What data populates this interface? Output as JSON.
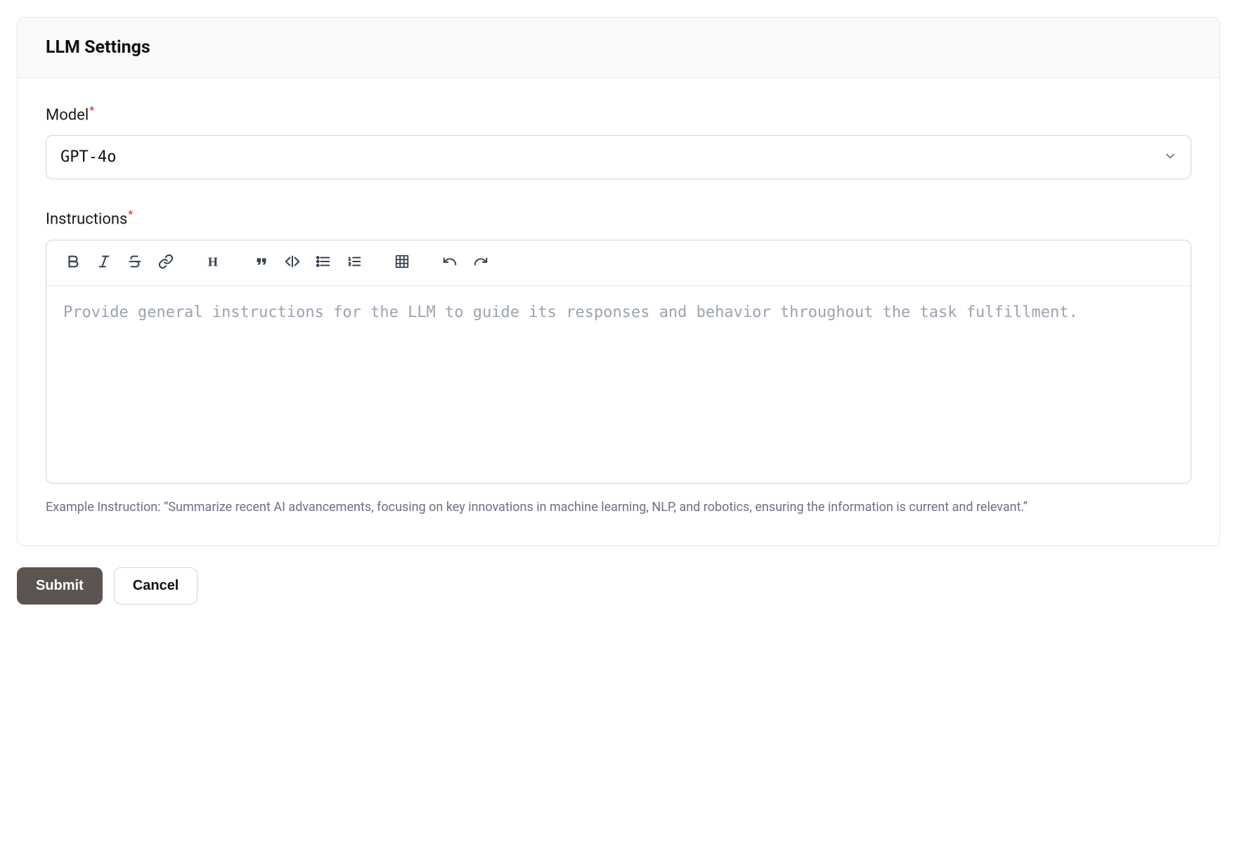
{
  "panel": {
    "title": "LLM Settings"
  },
  "model": {
    "label": "Model",
    "required": "*",
    "selected": "GPT-4o"
  },
  "instructions": {
    "label": "Instructions",
    "required": "*",
    "placeholder": "Provide general instructions for the LLM to guide its responses and behavior throughout the task fulfillment.",
    "help": "Example Instruction: “Summarize recent AI advancements, focusing on key innovations in machine learning, NLP, and robotics, ensuring the information is current and relevant.”"
  },
  "toolbar": {
    "bold": "bold-icon",
    "italic": "italic-icon",
    "strike": "strikethrough-icon",
    "link": "link-icon",
    "heading": "heading-icon",
    "quote": "quote-icon",
    "code": "code-icon",
    "ul": "unordered-list-icon",
    "ol": "ordered-list-icon",
    "table": "table-icon",
    "undo": "undo-icon",
    "redo": "redo-icon"
  },
  "actions": {
    "submit": "Submit",
    "cancel": "Cancel"
  }
}
